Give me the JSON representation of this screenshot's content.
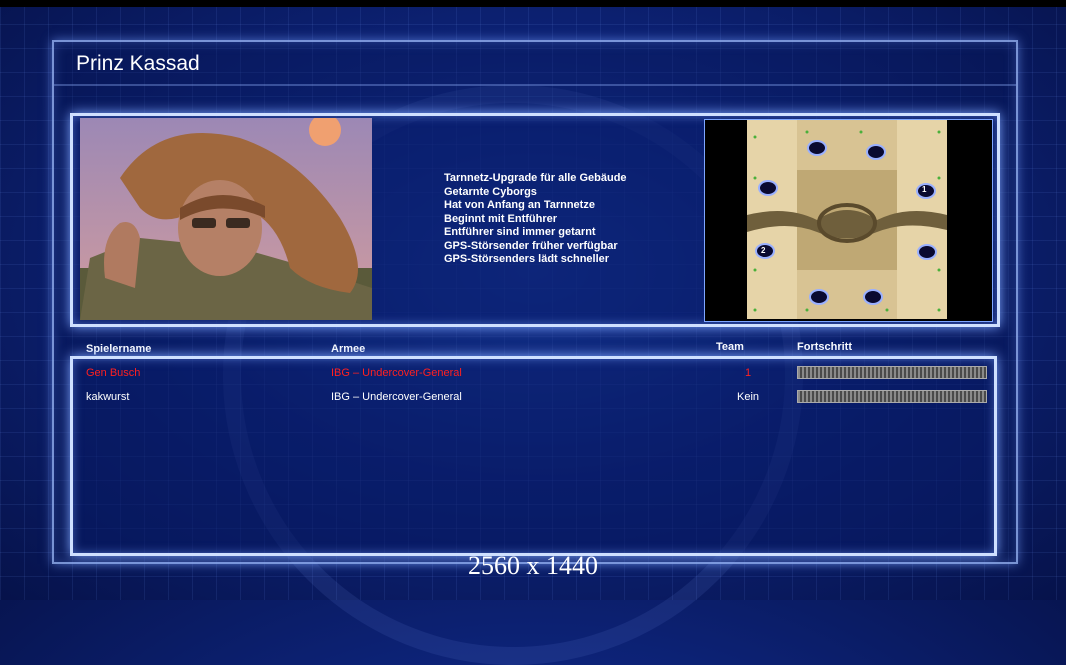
{
  "general_name": "Prinz Kassad",
  "features": [
    "Tarnnetz-Upgrade für alle Gebäude",
    "Getarnte Cyborgs",
    "Hat von Anfang an Tarnnetze",
    "Beginnt mit Entführer",
    "Entführer sind immer getarnt",
    "GPS-Störsender früher verfügbar",
    "GPS-Störsenders lädt schneller"
  ],
  "minimap": {
    "start_markers": [
      "1",
      "2"
    ]
  },
  "columns": {
    "player": "Spielername",
    "army": "Armee",
    "team": "Team",
    "progress": "Fortschritt"
  },
  "players": [
    {
      "name": "Gen Busch",
      "army": "IBG – Undercover-General",
      "team": "1",
      "progress": 0,
      "color": "#ff2020"
    },
    {
      "name": "kakwurst",
      "army": "IBG – Undercover-General",
      "team": "Kein",
      "progress": 0,
      "color": "#ffffff"
    }
  ],
  "resolution_label": "2560 x 1440",
  "colors": {
    "accent": "#cfe0ff",
    "background": "#0d2378",
    "player1": "#ff2020"
  }
}
